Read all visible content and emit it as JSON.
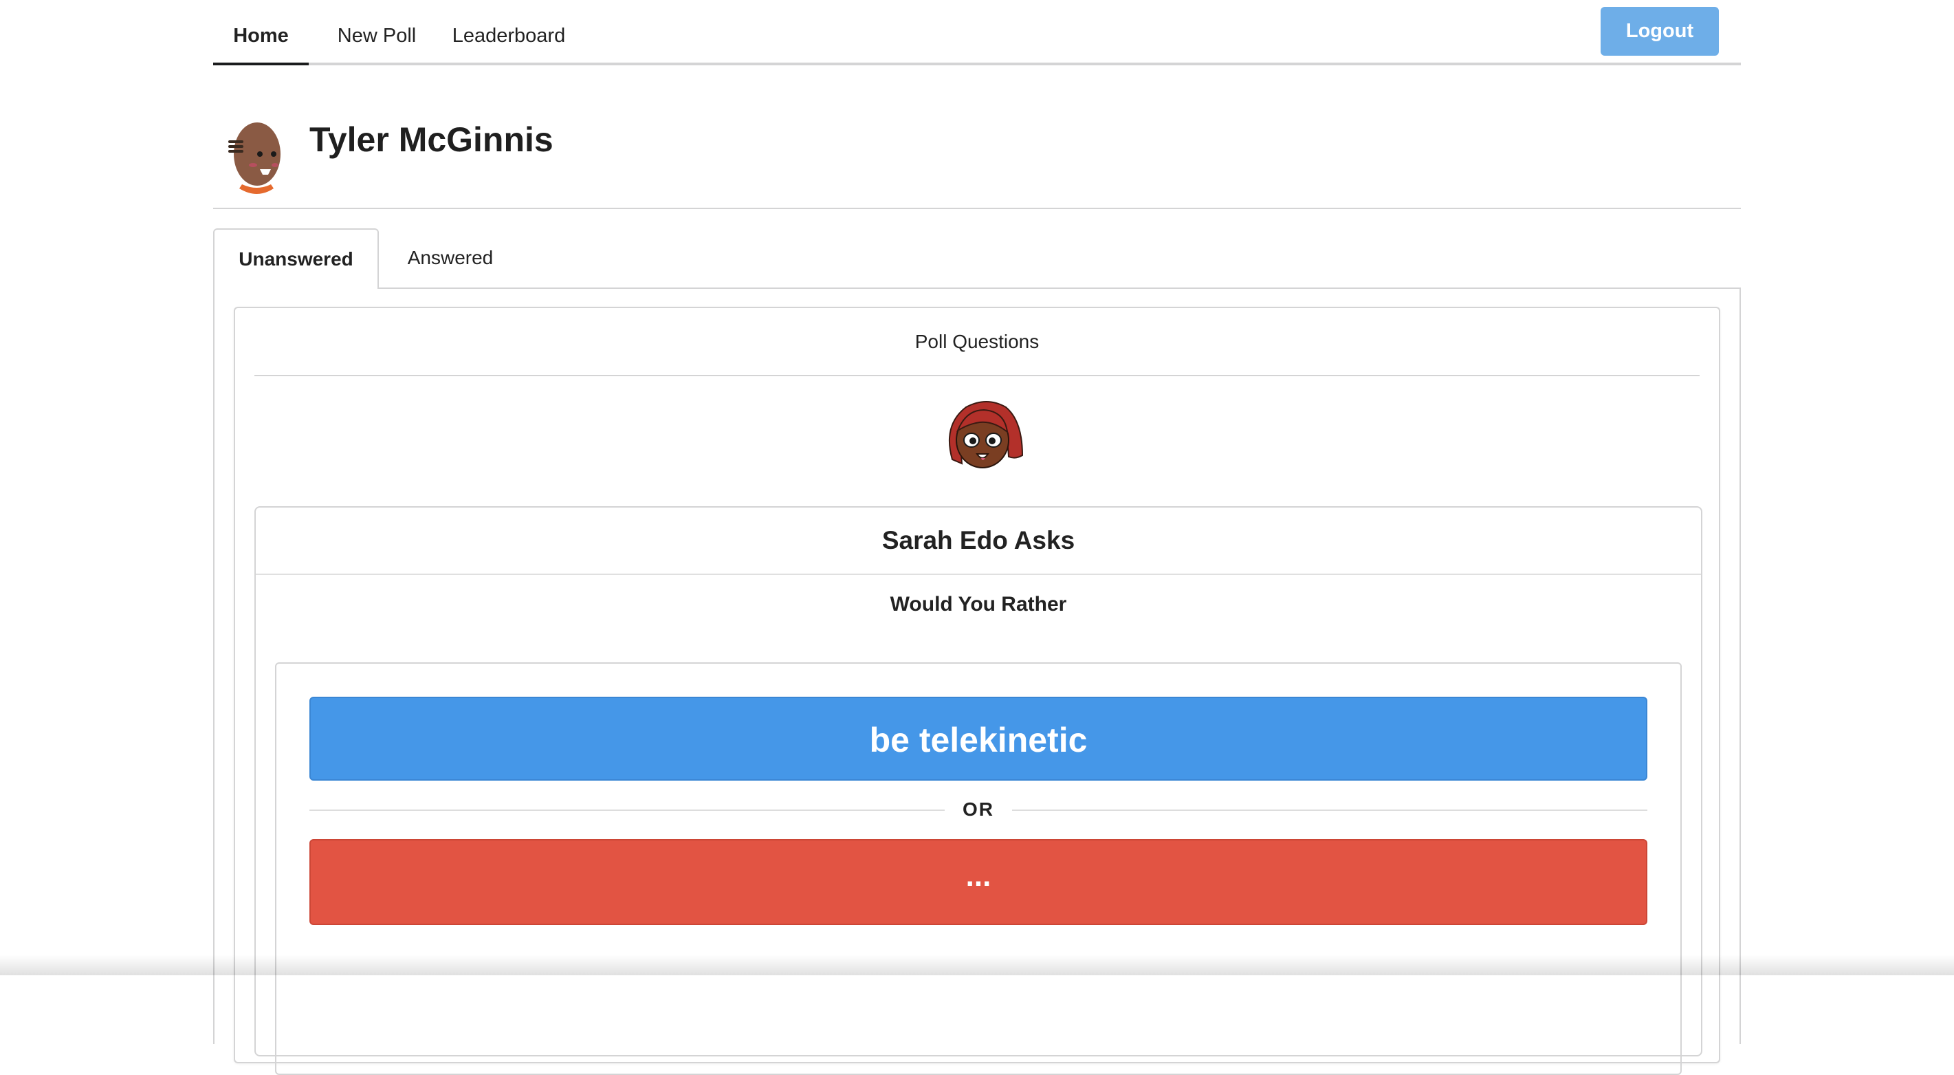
{
  "nav": {
    "items": [
      {
        "label": "Home",
        "active": true
      },
      {
        "label": "New Poll",
        "active": false
      },
      {
        "label": "Leaderboard",
        "active": false
      }
    ],
    "logout_label": "Logout",
    "logout_color": "#6eaee8"
  },
  "user": {
    "name": "Tyler McGinnis"
  },
  "tabs": [
    {
      "label": "Unanswered",
      "active": true
    },
    {
      "label": "Answered",
      "active": false
    }
  ],
  "poll": {
    "header": "Poll Questions",
    "author_title": "Sarah Edo Asks",
    "subtitle": "Would You Rather",
    "option_one": "be telekinetic",
    "option_one_color": "#4597e8",
    "divider_label": "OR",
    "option_two": "...",
    "option_two_color": "#e25443"
  }
}
